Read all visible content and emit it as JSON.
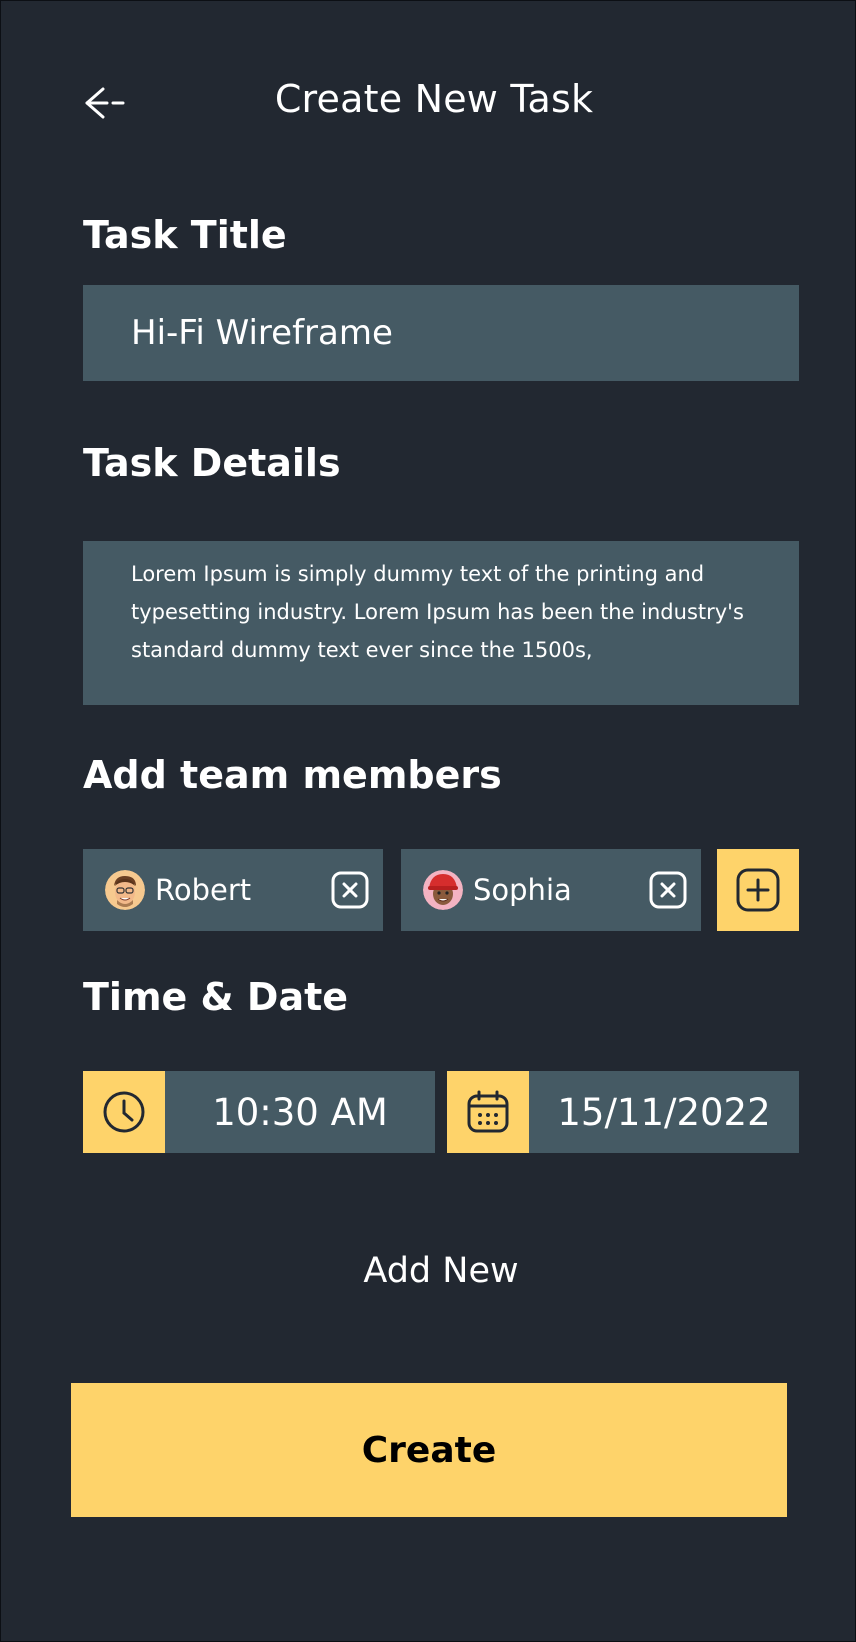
{
  "header": {
    "title": "Create New Task",
    "back_icon": "arrow-left-icon"
  },
  "task_title": {
    "label": "Task Title",
    "value": "Hi-Fi Wireframe"
  },
  "task_details": {
    "label": "Task Details",
    "value": "Lorem Ipsum is simply dummy text of the printing and typesetting industry. Lorem Ipsum has been the industry's standard dummy text ever since the 1500s,"
  },
  "team": {
    "label": "Add team members",
    "members": [
      {
        "name": "Robert",
        "avatar": "memoji-man-avatar"
      },
      {
        "name": "Sophia",
        "avatar": "memoji-woman-avatar"
      }
    ],
    "add_icon": "plus-square-icon",
    "remove_icon": "x-square-icon"
  },
  "schedule": {
    "label": "Time & Date",
    "time": "10:30 AM",
    "date": "15/11/2022",
    "time_icon": "clock-icon",
    "date_icon": "calendar-icon"
  },
  "actions": {
    "add_new": "Add New",
    "create": "Create"
  },
  "colors": {
    "background": "#222831",
    "field": "#455a64",
    "accent": "#fed36a",
    "text": "#ffffff"
  }
}
